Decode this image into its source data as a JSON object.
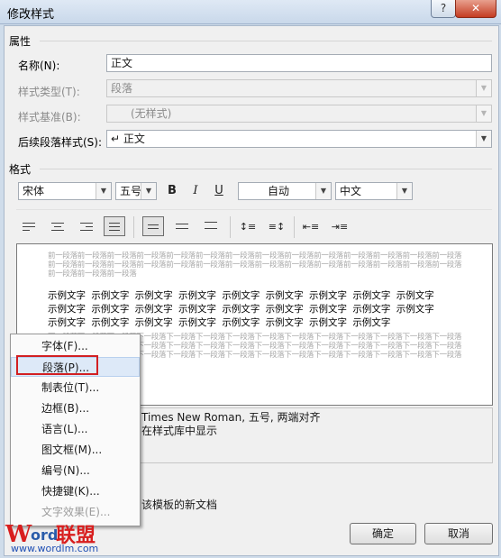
{
  "window": {
    "title": "修改样式",
    "help": "?",
    "close": "✕"
  },
  "properties": {
    "section": "属性",
    "name_label": "名称(N):",
    "name_value": "正文",
    "type_label": "样式类型(T):",
    "type_value": "段落",
    "base_label": "样式基准(B):",
    "base_value": "(无样式)",
    "next_label": "后续段落样式(S):",
    "next_value": "↵ 正文"
  },
  "format": {
    "section": "格式",
    "font": "宋体",
    "size": "五号",
    "bold": "B",
    "italic": "I",
    "underline": "U",
    "color": "自动",
    "lang": "中文"
  },
  "preview": {
    "prev_para": "前一段落前一段落前一段落前一段落前一段落前一段落前一段落前一段落前一段落前一段落前一段落前一段落前一段落前一段落前一段落前一段落前一段落前一段落",
    "prev_para_tail": "前一段落前一段落前一段落",
    "sample": "示例文字 示例文字 示例文字 示例文字 示例文字 示例文字 示例文字 示例文字 示例文字",
    "sample_tail": "示例文字 示例文字 示例文字 示例文字 示例文字 示例文字 示例文字 示例文字",
    "next_para": "下一段落下一段落下一段落下一段落下一段落下一段落下一段落下一段落下一段落下一段落下一段落下一段落下一段落下一段落"
  },
  "description": {
    "line1": "Times New Roman, 五号, 两端对齐",
    "line2": "在样式库中显示",
    "template_note": "该模板的新文档"
  },
  "buttons": {
    "ok": "确定",
    "cancel": "取消"
  },
  "menu": {
    "items": [
      {
        "label": "字体(F)...",
        "disabled": false
      },
      {
        "label": "段落(P)...",
        "disabled": false
      },
      {
        "label": "制表位(T)...",
        "disabled": false
      },
      {
        "label": "边框(B)...",
        "disabled": false
      },
      {
        "label": "语言(L)...",
        "disabled": false
      },
      {
        "label": "图文框(M)...",
        "disabled": false
      },
      {
        "label": "编号(N)...",
        "disabled": false
      },
      {
        "label": "快捷键(K)...",
        "disabled": false
      },
      {
        "label": "文字效果(E)...",
        "disabled": true
      }
    ]
  },
  "watermark": {
    "w": "W",
    "ord": "ord",
    "cn": "联盟",
    "url": "www.wordlm.com"
  },
  "colors": {
    "highlight_outline": "#d21f22",
    "menu_hover": "#dde9f8"
  }
}
